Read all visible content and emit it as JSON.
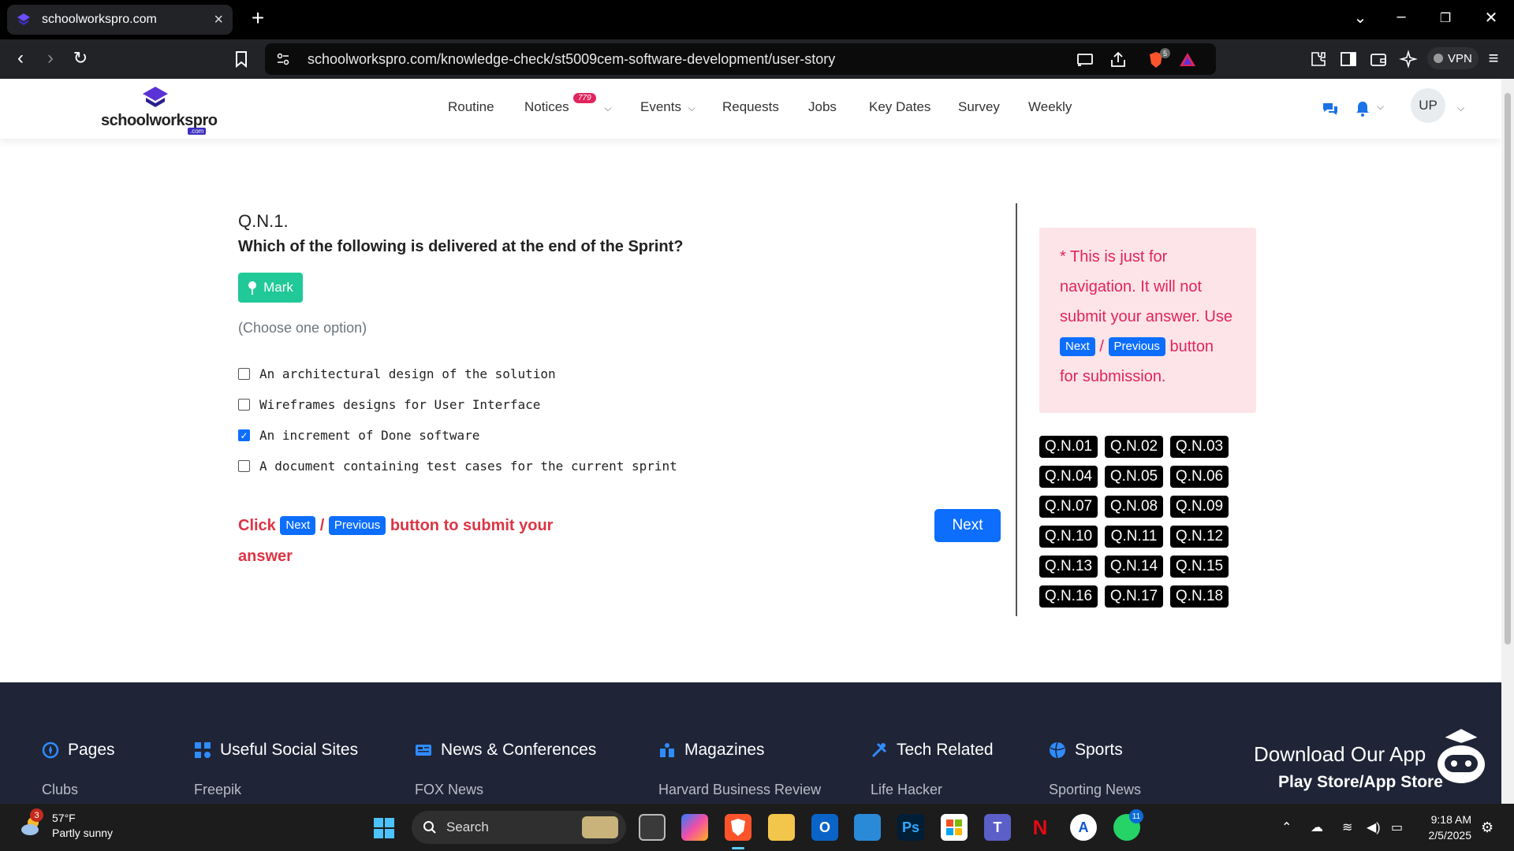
{
  "browser": {
    "tab_title": "schoolworkspro.com",
    "url": "schoolworkspro.com/knowledge-check/st5009cem-software-development/user-story",
    "shield_count": "5",
    "vpn_label": "VPN"
  },
  "site": {
    "logo_text": "schoolworkspro",
    "logo_suffix": ".com",
    "nav": {
      "routine": "Routine",
      "notices": "Notices",
      "notices_badge": "779",
      "events": "Events",
      "requests": "Requests",
      "jobs": "Jobs",
      "key_dates": "Key Dates",
      "survey": "Survey",
      "weekly": "Weekly"
    },
    "avatar_initials": "UP"
  },
  "question": {
    "number": "Q.N.1.",
    "text": "Which of the following is delivered at the end of the Sprint?",
    "mark_label": "Mark",
    "instruction": "(Choose one option)",
    "options": [
      {
        "label": "An architectural design of the solution",
        "checked": false
      },
      {
        "label": "Wireframes designs for User Interface",
        "checked": false
      },
      {
        "label": "An increment of Done software",
        "checked": true
      },
      {
        "label": "A document containing test cases for the current sprint",
        "checked": false
      }
    ],
    "submit_note": {
      "prefix": "Click",
      "next_chip": "Next",
      "slash": "/",
      "previous_chip": "Previous",
      "suffix": "button to submit your answer"
    },
    "next_button": "Next"
  },
  "navigation_panel": {
    "note_part1": "* This is just for navigation. It will not submit your answer. Use",
    "next_chip": "Next",
    "slash": "/",
    "previous_chip": "Previous",
    "note_part2": "button for submission.",
    "questions": [
      "Q.N.01",
      "Q.N.02",
      "Q.N.03",
      "Q.N.04",
      "Q.N.05",
      "Q.N.06",
      "Q.N.07",
      "Q.N.08",
      "Q.N.09",
      "Q.N.10",
      "Q.N.11",
      "Q.N.12",
      "Q.N.13",
      "Q.N.14",
      "Q.N.15",
      "Q.N.16",
      "Q.N.17",
      "Q.N.18"
    ]
  },
  "footer": {
    "columns": [
      {
        "title": "Pages",
        "icon": "compass-icon",
        "first_link": "Clubs"
      },
      {
        "title": "Useful Social Sites",
        "icon": "network-icon",
        "first_link": "Freepik"
      },
      {
        "title": "News & Conferences",
        "icon": "newspaper-icon",
        "first_link": "FOX News"
      },
      {
        "title": "Magazines",
        "icon": "people-icon",
        "first_link": "Harvard Business Review"
      },
      {
        "title": "Tech Related",
        "icon": "tools-icon",
        "first_link": "Life Hacker"
      },
      {
        "title": "Sports",
        "icon": "ball-icon",
        "first_link": "Sporting News"
      }
    ],
    "download_title": "Download Our App",
    "download_sub": "Play Store/App Store"
  },
  "taskbar": {
    "weather_temp": "57°F",
    "weather_desc": "Partly sunny",
    "weather_badge": "3",
    "search_label": "Search",
    "whatsapp_badge": "11",
    "time": "9:18 AM",
    "date": "2/5/2025"
  },
  "colors": {
    "primary": "#0d6efd",
    "mark_green": "#20c997",
    "danger": "#dc3545",
    "pink_text": "#e0245e",
    "pink_bg": "#fde4e8",
    "footer_bg": "#1f2537"
  }
}
